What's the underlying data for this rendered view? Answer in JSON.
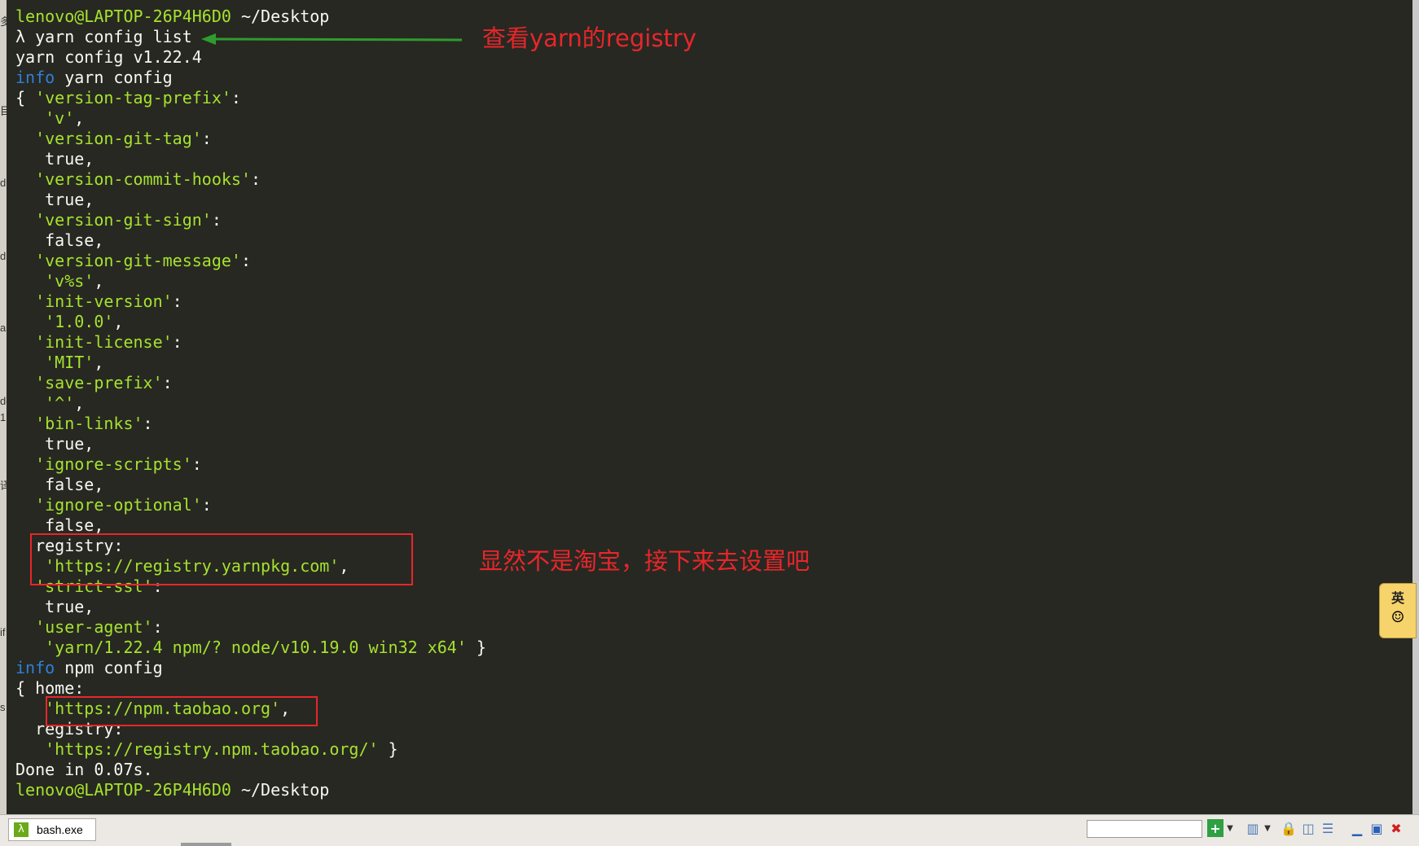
{
  "terminal": {
    "prompt_user": "lenovo@LAPTOP-26P4H6D0",
    "prompt_path": "~/Desktop",
    "command": "λ yarn config list",
    "yarn_version_line": "yarn config v1.22.4",
    "info_label": "info",
    "yarn_config_label": " yarn config",
    "yarn_config": [
      {
        "key": "'version-tag-prefix'",
        "value": "'v'"
      },
      {
        "key": "'version-git-tag'",
        "value": "true"
      },
      {
        "key": "'version-commit-hooks'",
        "value": "true"
      },
      {
        "key": "'version-git-sign'",
        "value": "false"
      },
      {
        "key": "'version-git-message'",
        "value": "'v%s'"
      },
      {
        "key": "'init-version'",
        "value": "'1.0.0'"
      },
      {
        "key": "'init-license'",
        "value": "'MIT'"
      },
      {
        "key": "'save-prefix'",
        "value": "'^'"
      },
      {
        "key": "'bin-links'",
        "value": "true"
      },
      {
        "key": "'ignore-scripts'",
        "value": "false"
      },
      {
        "key": "'ignore-optional'",
        "value": "false"
      },
      {
        "key": "registry",
        "value": "'https://registry.yarnpkg.com'"
      },
      {
        "key": "'strict-ssl'",
        "value": "true"
      },
      {
        "key": "'user-agent'",
        "value": "'yarn/1.22.4 npm/? node/v10.19.0 win32 x64'"
      }
    ],
    "npm_config_label": " npm config",
    "npm_config": [
      {
        "key": "home",
        "value": "'https://npm.taobao.org'"
      },
      {
        "key": "registry",
        "value": "'https://registry.npm.taobao.org/'"
      }
    ],
    "done_line": "Done in 0.07s."
  },
  "annotations": {
    "view_registry": "查看yarn的registry",
    "not_taobao": "显然不是淘宝，接下来去设置吧"
  },
  "ime": {
    "char": "英"
  },
  "statusbar": {
    "task_label": "bash.exe",
    "search_value": ""
  },
  "colors": {
    "background": "#272822",
    "prompt_green": "#a6e22e",
    "info_blue": "#2f7fd8",
    "annotation_red": "#e8262a",
    "arrow_green": "#2e9c2e"
  }
}
